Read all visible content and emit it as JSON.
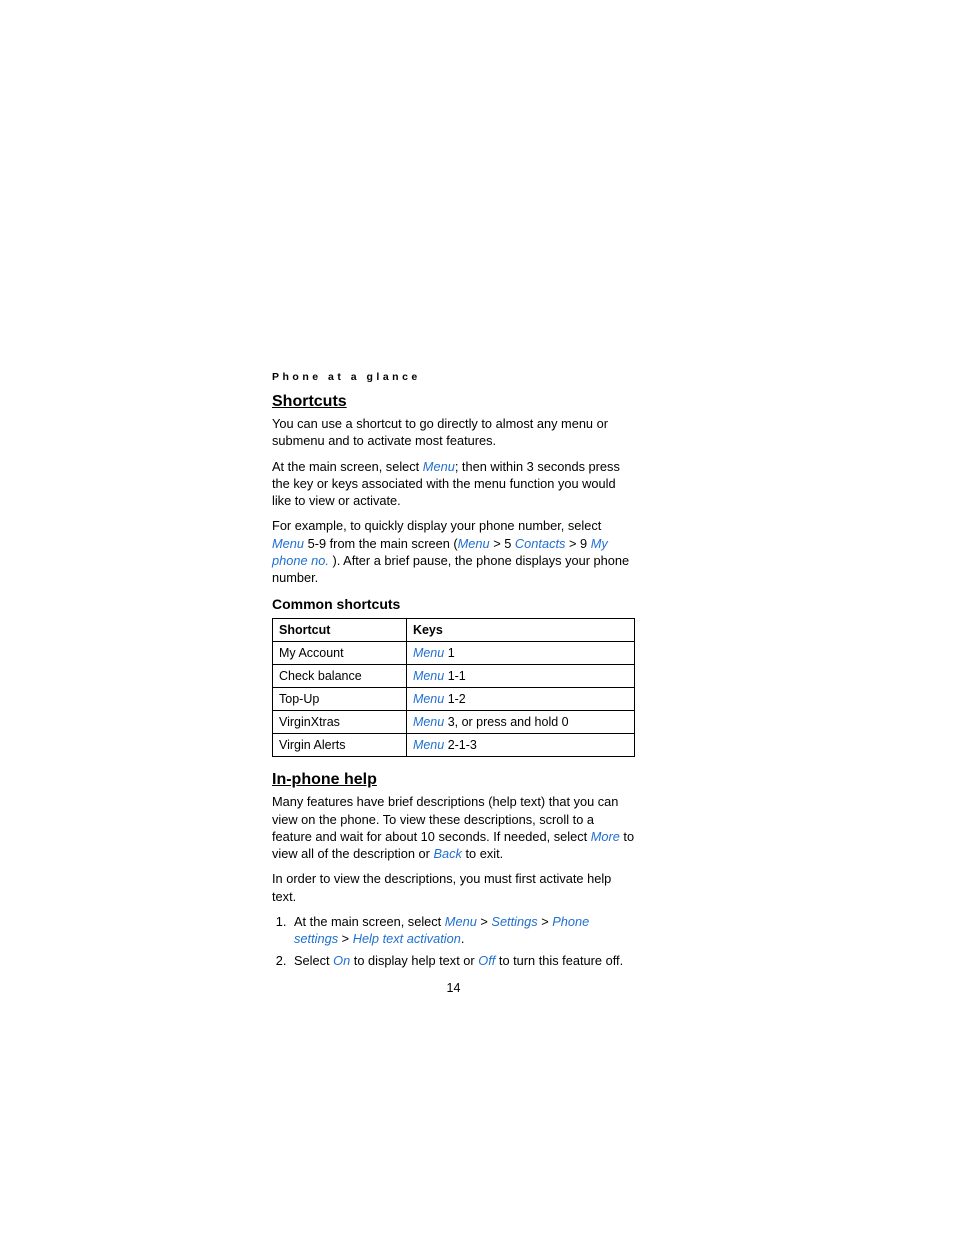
{
  "header": {
    "section": "Phone at a glance"
  },
  "shortcuts": {
    "heading": "Shortcuts",
    "intro": "You can use a shortcut to go directly to almost any menu or submenu and to activate most features.",
    "p2_prefix": "At the main screen, select ",
    "p2_menu": "Menu",
    "p2_suffix": "; then within 3 seconds press the key or keys associated with the menu function you would like to view or activate.",
    "p3_a": "For example, to quickly display your phone number, select ",
    "p3_menu1": "Menu",
    "p3_b": " 5-9 from the main screen (",
    "p3_menu2": "Menu",
    "p3_c": " > 5 ",
    "p3_contacts": "Contacts",
    "p3_d": "  > 9 ",
    "p3_myphone": "My phone no.",
    "p3_e": " ). After a brief pause, the phone displays your phone number.",
    "common_heading": "Common shortcuts",
    "table": {
      "col_shortcut": "Shortcut",
      "col_keys": "Keys",
      "rows": [
        {
          "shortcut": "My Account",
          "menu": "Menu",
          "after": " 1"
        },
        {
          "shortcut": "Check balance",
          "menu": "Menu",
          "after": " 1-1"
        },
        {
          "shortcut": "Top-Up",
          "menu": "Menu",
          "after": " 1-2"
        },
        {
          "shortcut": "VirginXtras",
          "menu": "Menu",
          "after": " 3, or press and hold 0"
        },
        {
          "shortcut": "Virgin Alerts",
          "menu": "Menu",
          "after": " 2-1-3"
        }
      ]
    }
  },
  "inphone": {
    "heading": "In-phone help",
    "p1_a": "Many features have brief descriptions (help text) that you can view on the phone. To view these descriptions, scroll to a feature and wait for about 10 seconds. If needed, select ",
    "p1_more": "More",
    "p1_b": " to view all of the description or ",
    "p1_back": "Back",
    "p1_c": " to exit.",
    "p2": "In order to view the descriptions, you must first activate help text.",
    "step1_a": "At the main screen, select ",
    "step1_menu": "Menu",
    "step1_b": " > ",
    "step1_settings": "Settings",
    "step1_c": " > ",
    "step1_phone": "Phone settings",
    "step1_d": " > ",
    "step1_help": "Help text activation",
    "step1_e": ".",
    "step2_a": "Select ",
    "step2_on": "On",
    "step2_b": " to display help text or ",
    "step2_off": "Off",
    "step2_c": " to turn this feature off."
  },
  "page_number": "14"
}
